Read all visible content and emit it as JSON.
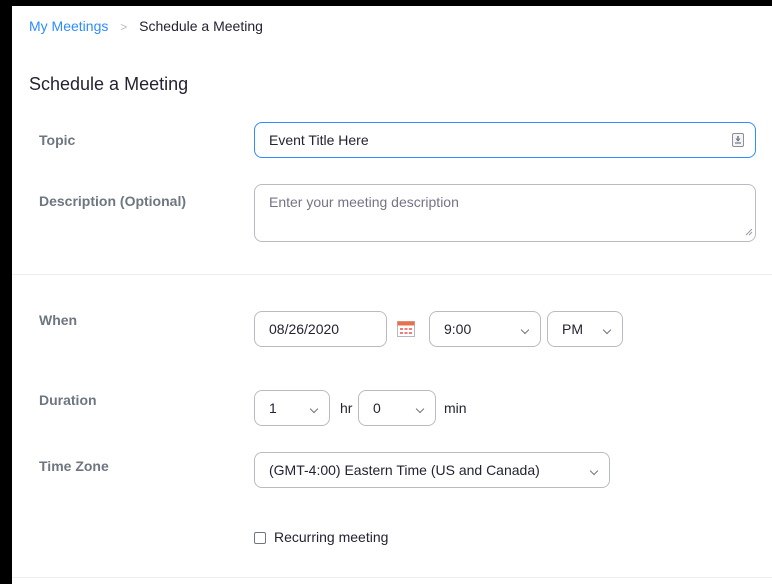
{
  "breadcrumb": {
    "parent": "My Meetings",
    "separator": ">",
    "current": "Schedule a Meeting"
  },
  "page_title": "Schedule a Meeting",
  "topic": {
    "label": "Topic",
    "value": "Event Title Here"
  },
  "description": {
    "label": "Description (Optional)",
    "placeholder": "Enter your meeting description"
  },
  "when": {
    "label": "When",
    "date": "08/26/2020",
    "time": "9:00",
    "ampm": "PM"
  },
  "duration": {
    "label": "Duration",
    "hours": "1",
    "hours_unit": "hr",
    "minutes": "0",
    "minutes_unit": "min"
  },
  "timezone": {
    "label": "Time Zone",
    "value": "(GMT-4:00) Eastern Time (US and Canada)"
  },
  "recurring": {
    "label": "Recurring meeting",
    "checked": false
  },
  "colors": {
    "accent": "#2d8cff",
    "text": "#232333",
    "label": "#6e7680",
    "border": "#babac4"
  },
  "icons": {
    "topic_field": "field-info-icon",
    "date": "calendar-icon",
    "dropdown": "chevron-down-icon"
  }
}
